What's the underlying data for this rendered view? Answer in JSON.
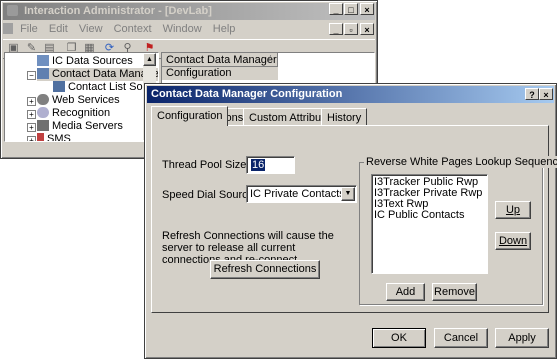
{
  "bg_window": {
    "title": "Interaction Administrator - [DevLab]",
    "menu": [
      "File",
      "Edit",
      "View",
      "Context",
      "Window",
      "Help"
    ],
    "tree": [
      {
        "label": "IC Data Sources",
        "expander": ""
      },
      {
        "label": "Contact Data Manager",
        "expander": "-"
      },
      {
        "label": "Contact List Sources",
        "expander": ""
      },
      {
        "label": "Web Services",
        "expander": "+"
      },
      {
        "label": "Recognition",
        "expander": "+"
      },
      {
        "label": "Media Servers",
        "expander": "+"
      },
      {
        "label": "SMS",
        "expander": "+"
      }
    ],
    "list_header": "Contact Data Manager",
    "list_rows": [
      "Configuration"
    ]
  },
  "dialog": {
    "title": "Contact Data Manager Configuration",
    "help_button": "?",
    "close_button": "×",
    "tabs": [
      "Configuration",
      "Icons",
      "Custom Attributes",
      "History"
    ],
    "active_tab": 0,
    "thread_pool_label": "Thread Pool Size:",
    "thread_pool_value": "16",
    "speed_dial_label": "Speed Dial Source:",
    "speed_dial_value": "IC Private Contacts",
    "refresh_note": "Refresh Connections will cause the server to release all current connections and re-connect.",
    "refresh_button": "Refresh Connections",
    "lookup_group_label": "Reverse White Pages Lookup Sequence",
    "lookup_items": [
      "I3Tracker Public Rwp",
      "I3Tracker Private Rwp",
      "I3Text Rwp",
      "IC Public Contacts"
    ],
    "up_button": "Up",
    "down_button": "Down",
    "add_button": "Add",
    "remove_button": "Remove",
    "ok_button": "OK",
    "cancel_button": "Cancel",
    "apply_button": "Apply"
  },
  "colors": {
    "active_title_start": "#0a246a",
    "active_title_end": "#a6caf0",
    "face": "#d4d0c8"
  }
}
